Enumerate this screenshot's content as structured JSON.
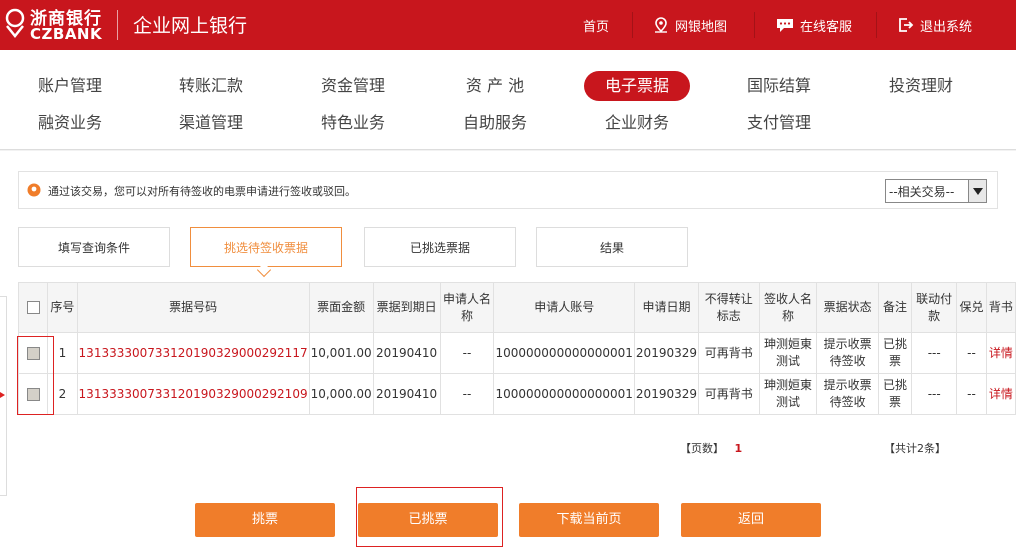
{
  "header": {
    "logo_cn": "浙商银行",
    "logo_en": "CZBANK",
    "title": "企业网上银行",
    "nav": [
      {
        "label": "首页",
        "icon": ""
      },
      {
        "label": "网银地图",
        "icon": "map-pin-icon"
      },
      {
        "label": "在线客服",
        "icon": "chat-icon"
      },
      {
        "label": "退出系统",
        "icon": "logout-icon"
      }
    ]
  },
  "menu": {
    "row1": [
      "账户管理",
      "转账汇款",
      "资金管理",
      "资 产 池",
      "电子票据",
      "国际结算",
      "投资理财"
    ],
    "row2": [
      "融资业务",
      "渠道管理",
      "特色业务",
      "自助服务",
      "企业财务",
      "支付管理"
    ],
    "active": "电子票据"
  },
  "info": {
    "text": "通过该交易，您可以对所有待签收的电票申请进行签收或驳回。",
    "related_select": "--相关交易--"
  },
  "steps": [
    "填写查询条件",
    "挑选待签收票据",
    "已挑选票据",
    "结果"
  ],
  "table": {
    "headers": [
      "序号",
      "票据号码",
      "票面金额",
      "票据到期日",
      "申请人名称",
      "申请人账号",
      "申请日期",
      "不得转让标志",
      "签收人名称",
      "票据状态",
      "备注",
      "联动付款",
      "保兑",
      "背书"
    ],
    "rows": [
      {
        "no": "1",
        "bill": "131333300733120190329000292117",
        "amount": "10,001.00",
        "due": "20190410",
        "applicant": "--",
        "account": "100000000000000001",
        "apply_date": "20190329",
        "flag": "可再背书",
        "signer": "珅测姮東测试",
        "status": "提示收票待签收",
        "remark": "已挑票",
        "linked": "---",
        "guarantee": "--",
        "endorse": "详情"
      },
      {
        "no": "2",
        "bill": "131333300733120190329000292109",
        "amount": "10,000.00",
        "due": "20190410",
        "applicant": "--",
        "account": "100000000000000001",
        "apply_date": "20190329",
        "flag": "可再背书",
        "signer": "珅测姮東测试",
        "status": "提示收票待签收",
        "remark": "已挑票",
        "linked": "---",
        "guarantee": "--",
        "endorse": "详情"
      }
    ]
  },
  "pager": {
    "pages_label": "【页数】",
    "page": "1",
    "total": "【共计2条】"
  },
  "buttons": [
    "挑票",
    "已挑票",
    "下载当前页",
    "返回"
  ],
  "colors": {
    "brand_red": "#c8161d",
    "button_orange": "#f07d2a"
  }
}
